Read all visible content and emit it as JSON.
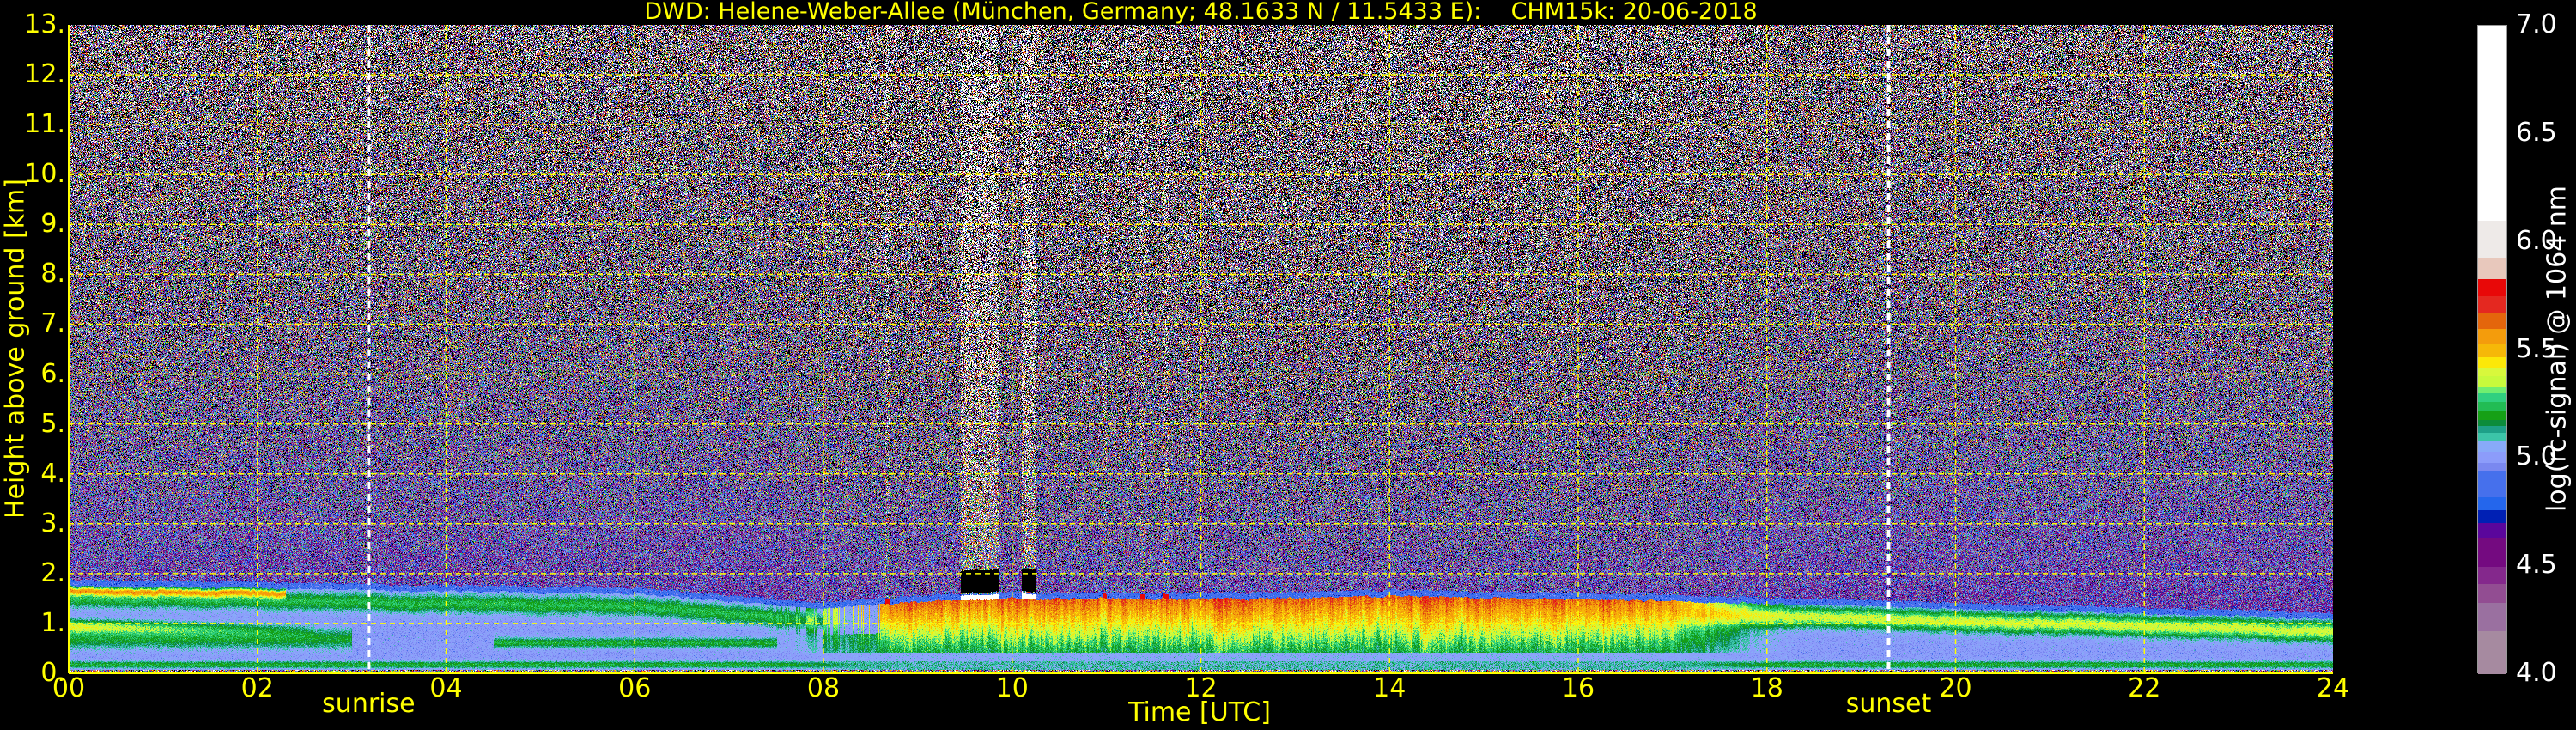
{
  "chart_data": {
    "type": "heatmap",
    "title": "DWD: Helene-Weber-Allee (München, Germany; 48.1633 N / 11.5433 E):    CHM15k: 20-06-2018",
    "xlabel": "Time [UTC]",
    "ylabel": "Height above ground [km]",
    "xlim": [
      0,
      24
    ],
    "ylim": [
      0,
      13
    ],
    "xticks": [
      "00",
      "02",
      "04",
      "06",
      "08",
      "10",
      "12",
      "14",
      "16",
      "18",
      "20",
      "22",
      "24"
    ],
    "yticks": [
      "0.",
      "1.",
      "2.",
      "3.",
      "4.",
      "5.",
      "6.",
      "7.",
      "8.",
      "9.",
      "10.",
      "11.",
      "12.",
      "13."
    ],
    "grid": true,
    "annotations": [
      {
        "label": "sunrise",
        "time_utc": 3.18
      },
      {
        "label": "sunset",
        "time_utc": 19.29
      }
    ],
    "boundary_layer_top_km": {
      "time": [
        0,
        2,
        4,
        6,
        8,
        9,
        10,
        12,
        14,
        16,
        18,
        20,
        22,
        24
      ],
      "height": [
        1.75,
        1.72,
        1.65,
        1.6,
        1.3,
        1.45,
        1.5,
        1.5,
        1.55,
        1.5,
        1.4,
        1.3,
        1.2,
        1.1
      ]
    },
    "cloud_periods_utc": [
      [
        8.65,
        8.7
      ],
      [
        9.45,
        9.85
      ],
      [
        10.1,
        10.25
      ],
      [
        10.95,
        11.0
      ],
      [
        11.35,
        11.4
      ],
      [
        11.6,
        11.65
      ]
    ],
    "colorbar": {
      "label": "log(rc-signal) @ 1064 nm",
      "range": [
        4.0,
        7.0
      ],
      "ticks": [
        "4.0",
        "4.5",
        "5.0",
        "5.5",
        "6.0",
        "6.5",
        "7.0"
      ],
      "levels": [
        {
          "from": 4.0,
          "to": 4.2,
          "color": "#a68aa0"
        },
        {
          "from": 4.2,
          "to": 4.33,
          "color": "#9a70a0"
        },
        {
          "from": 4.33,
          "to": 4.42,
          "color": "#924d92"
        },
        {
          "from": 4.42,
          "to": 4.5,
          "color": "#84288c"
        },
        {
          "from": 4.5,
          "to": 4.63,
          "color": "#740a80"
        },
        {
          "from": 4.63,
          "to": 4.7,
          "color": "#5a069c"
        },
        {
          "from": 4.7,
          "to": 4.76,
          "color": "#0020b4"
        },
        {
          "from": 4.76,
          "to": 4.82,
          "color": "#2466ec"
        },
        {
          "from": 4.82,
          "to": 4.94,
          "color": "#4670ec"
        },
        {
          "from": 4.94,
          "to": 4.98,
          "color": "#7a88f0"
        },
        {
          "from": 4.98,
          "to": 5.03,
          "color": "#8c9cfa"
        },
        {
          "from": 5.03,
          "to": 5.08,
          "color": "#88aaf8"
        },
        {
          "from": 5.08,
          "to": 5.12,
          "color": "#3cc4a8"
        },
        {
          "from": 5.12,
          "to": 5.15,
          "color": "#1ea088"
        },
        {
          "from": 5.15,
          "to": 5.18,
          "color": "#0c8c3c"
        },
        {
          "from": 5.18,
          "to": 5.22,
          "color": "#16a016"
        },
        {
          "from": 5.22,
          "to": 5.26,
          "color": "#22bc54"
        },
        {
          "from": 5.26,
          "to": 5.3,
          "color": "#30d080"
        },
        {
          "from": 5.3,
          "to": 5.33,
          "color": "#70ee70"
        },
        {
          "from": 5.33,
          "to": 5.38,
          "color": "#c8fa3c"
        },
        {
          "from": 5.38,
          "to": 5.42,
          "color": "#d8f83c"
        },
        {
          "from": 5.42,
          "to": 5.47,
          "color": "#fce808"
        },
        {
          "from": 5.47,
          "to": 5.53,
          "color": "#f6b808"
        },
        {
          "from": 5.53,
          "to": 5.6,
          "color": "#f49c0c"
        },
        {
          "from": 5.6,
          "to": 5.67,
          "color": "#e4660c"
        },
        {
          "from": 5.67,
          "to": 5.75,
          "color": "#e42820"
        },
        {
          "from": 5.75,
          "to": 5.83,
          "color": "#e80808"
        },
        {
          "from": 5.83,
          "to": 5.93,
          "color": "#e8c8bc"
        },
        {
          "from": 5.93,
          "to": 6.1,
          "color": "#eeeae8"
        },
        {
          "from": 6.1,
          "to": 7.0,
          "color": "#ffffff"
        }
      ]
    }
  },
  "colors": {
    "axis_text": "#ffff00",
    "grid": "#ffff00",
    "colorbar_text": "#ffffff",
    "sun_line": "#ffffff"
  }
}
